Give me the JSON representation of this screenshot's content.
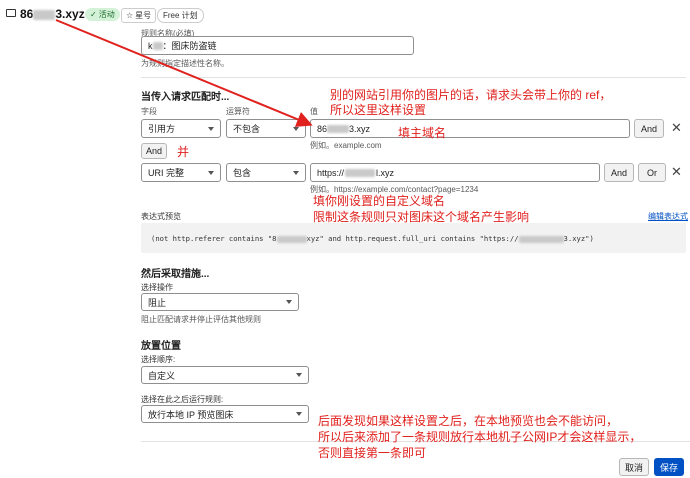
{
  "header": {
    "domain_prefix": "86",
    "domain_suffix": "3.xyz",
    "status_badge": "活动",
    "star_label": "星号",
    "plan_badge": "Free 计划"
  },
  "description": {
    "value_prefix": "k",
    "value_text": "：图床防盗链",
    "help": "为规则指定描述性名称。"
  },
  "match_section": {
    "title": "当传入请求匹配时...",
    "col_field": "字段",
    "col_operator": "运算符",
    "col_value": "值",
    "rule1": {
      "field": "引用方",
      "operator": "不包含",
      "value_prefix": "86",
      "value_suffix": "3.xyz",
      "example": "例如。example.com",
      "and_btn": "And"
    },
    "and_separator": "And",
    "rule2": {
      "field": "URI 完整",
      "operator": "包含",
      "value_prefix": "https://",
      "value_suffix": "l.xyz",
      "example": "例如。https://example.com/contact?page=1234",
      "and_btn": "And",
      "or_btn": "Or"
    }
  },
  "expression": {
    "title": "表达式预览",
    "edit_link": "编辑表达式",
    "part1": "(not http.referer contains \"8",
    "part2": "xyz\" and http.request.full_uri contains \"https://",
    "part3": "3.xyz\")"
  },
  "action_section": {
    "title": "然后采取措施...",
    "label": "选择操作",
    "value": "阻止",
    "help": "阻止匹配请求并停止评估其他规则"
  },
  "placement_section": {
    "title": "放置位置",
    "order_label": "选择顺序:",
    "order_value": "自定义",
    "after_label": "选择在此之后运行规则:",
    "after_value": "放行本地 IP 预览图床"
  },
  "footer": {
    "cancel": "取消",
    "save": "保存"
  },
  "annotations": {
    "a1_line1": "别的网站引用你的图片的话，请求头会带上你的 ref，",
    "a1_line2": "所以这里这样设置",
    "a2": "填主域名",
    "a3": "并",
    "a4_line1": "填你刚设置的自定义域名",
    "a4_line2": "限制这条规则只对图床这个域名产生影响",
    "a5_line1": "后面发现如果这样设置之后，在本地预览也会不能访问，",
    "a5_line2": "所以后来添加了一条规则放行本地机子公网IP才会这样显示，",
    "a5_line3": "否则直接第一条即可"
  },
  "colors": {
    "annotation_red": "#e0211d",
    "primary_blue": "#0051c3",
    "active_green": "#d4f2d8"
  }
}
